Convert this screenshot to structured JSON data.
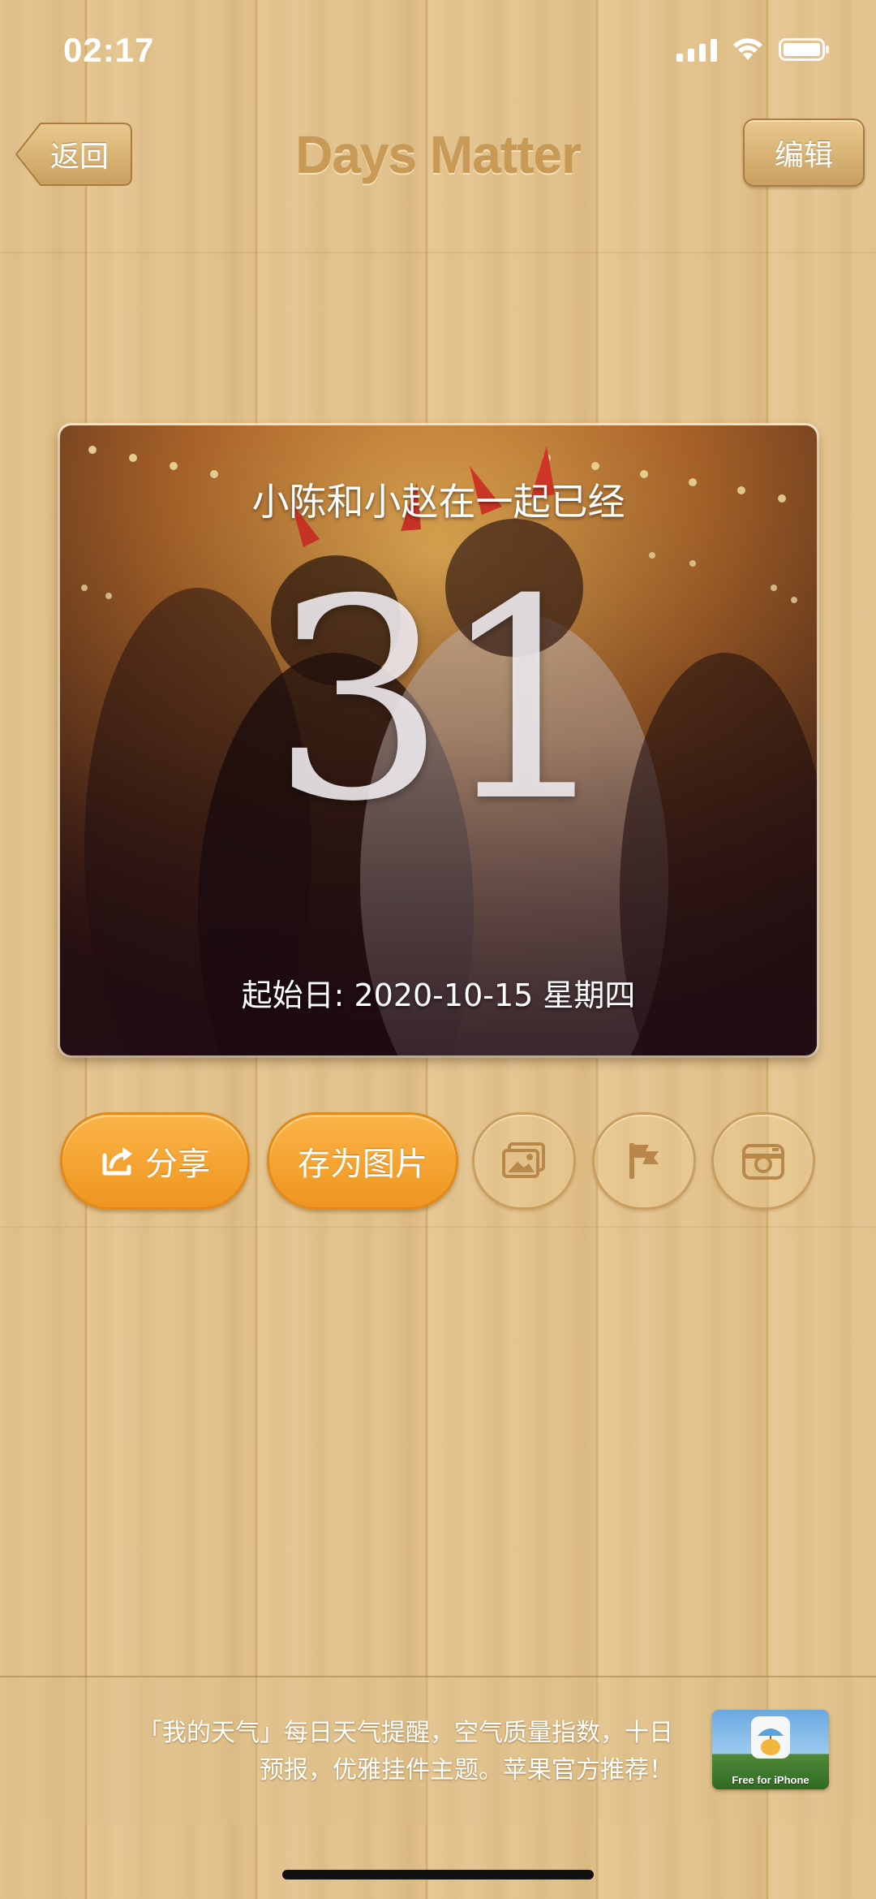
{
  "status_bar": {
    "time": "02:17"
  },
  "nav": {
    "back_label": "返回",
    "title": "Days Matter",
    "edit_label": "编辑"
  },
  "event": {
    "title": "小陈和小赵在一起已经",
    "days": "31",
    "start_label": "起始日: 2020-10-15 星期四"
  },
  "actions": {
    "share_label": "分享",
    "save_image_label": "存为图片",
    "icons": [
      "share-icon",
      "background-image-icon",
      "flag-icon",
      "camera-icon"
    ]
  },
  "ad": {
    "line1": "「我的天气」每日天气提醒，空气质量指数，十日",
    "line2": "预报，优雅挂件主题。苹果官方推荐！",
    "app_caption": "Free for iPhone"
  },
  "colors": {
    "accent_orange": "#f5a22e",
    "wood": "#e2c18b",
    "title_tan": "#c99a55"
  }
}
